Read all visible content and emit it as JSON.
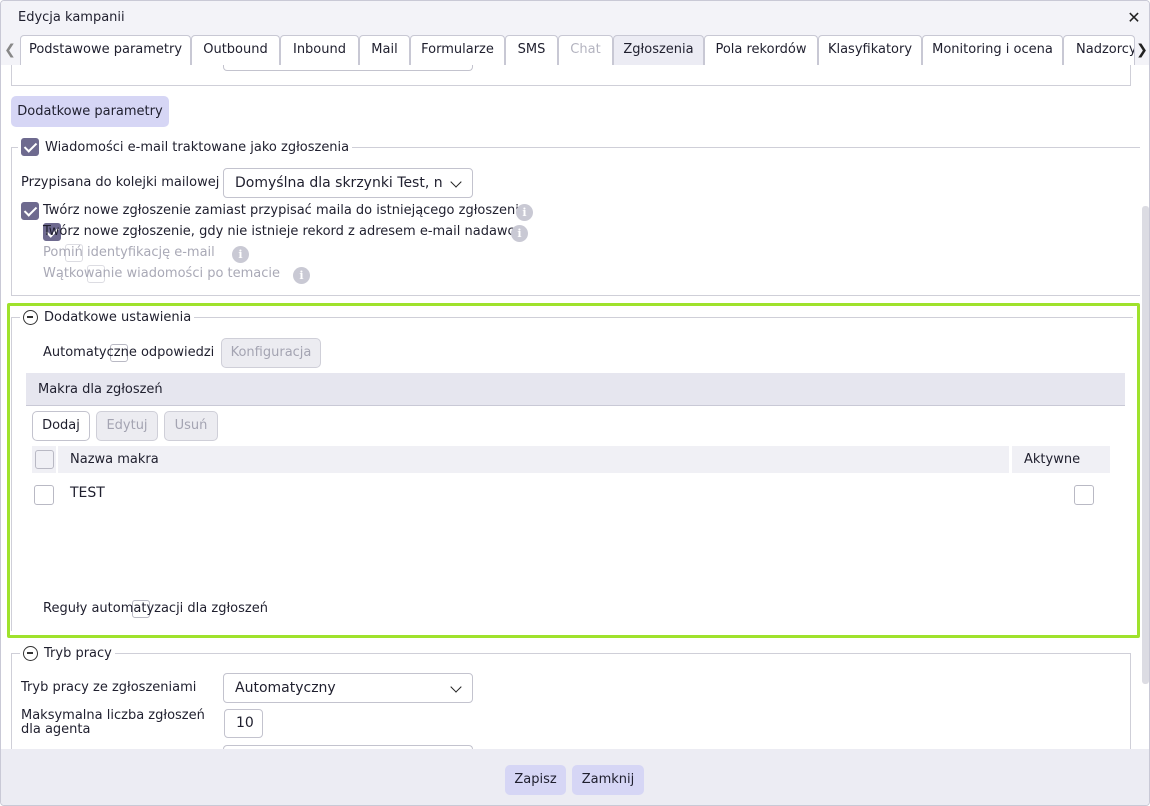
{
  "window": {
    "title": "Edycja kampanii",
    "close_icon": "close-icon"
  },
  "tabs": [
    {
      "label": "Podstawowe parametry",
      "state": "normal"
    },
    {
      "label": "Outbound",
      "state": "normal"
    },
    {
      "label": "Inbound",
      "state": "normal"
    },
    {
      "label": "Mail",
      "state": "normal"
    },
    {
      "label": "Formularze",
      "state": "normal"
    },
    {
      "label": "SMS",
      "state": "normal"
    },
    {
      "label": "Chat",
      "state": "disabled"
    },
    {
      "label": "Zgłoszenia",
      "state": "active"
    },
    {
      "label": "Pola rekordów",
      "state": "normal"
    },
    {
      "label": "Klasyfikatory",
      "state": "normal"
    },
    {
      "label": "Monitoring i ocena",
      "state": "normal"
    },
    {
      "label": "Nadzorcy",
      "state": "normal"
    }
  ],
  "extra_params_button": "Dodatkowe parametry",
  "email_section": {
    "legend": "Wiadomości e-mail traktowane jako zgłoszenia",
    "legend_checked": true,
    "queue_label": "Przypisana do kolejki mailowej",
    "queue_value": "Domyślna dla skrzynki Test, n",
    "options": [
      {
        "label": "Twórz nowe zgłoszenie zamiast przypisać maila do istniejącego zgłoszenia",
        "checked": true,
        "disabled": false
      },
      {
        "label": "Twórz nowe zgłoszenie, gdy nie istnieje rekord z adresem e-mail nadawcy",
        "checked": true,
        "disabled": false
      },
      {
        "label": "Pomiń identyfikację e-mail",
        "checked": false,
        "disabled": true
      },
      {
        "label": "Wątkowanie wiadomości po temacie",
        "checked": false,
        "disabled": true
      }
    ],
    "info_glyph": "i"
  },
  "additional_settings": {
    "legend": "Dodatkowe ustawienia",
    "auto_reply_label": "Automatyczne odpowiedzi",
    "auto_reply_checked": false,
    "config_button": "Konfiguracja",
    "macros": {
      "header": "Makra dla zgłoszeń",
      "add_button": "Dodaj",
      "edit_button": "Edytuj",
      "delete_button": "Usuń",
      "columns": {
        "name": "Nazwa makra",
        "active": "Aktywne"
      },
      "rows": [
        {
          "name": "TEST",
          "selected": false,
          "active": false
        }
      ]
    },
    "automation_rules_label": "Reguły automatyzacji dla zgłoszeń",
    "automation_rules_checked": false
  },
  "work_mode": {
    "legend": "Tryb pracy",
    "mode_label": "Tryb pracy ze zgłoszeniami",
    "mode_value": "Automatyczny",
    "max_label": "Maksymalna liczba zgłoszeń dla agenta",
    "max_value": "10"
  },
  "footer": {
    "save_button": "Zapisz",
    "close_button": "Zamknij"
  }
}
